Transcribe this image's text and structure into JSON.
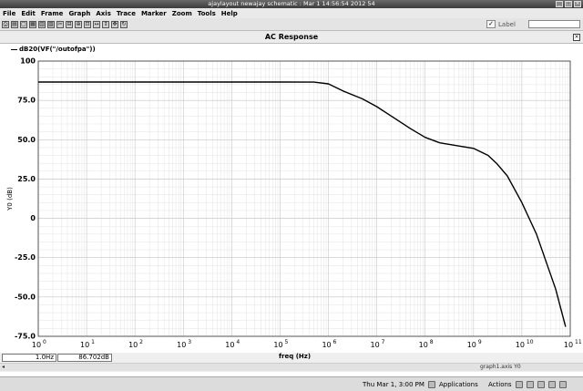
{
  "window": {
    "title": "ajaylayout newajay schematic : Mar  1 14:56:54 2012 54",
    "buttons": [
      "_",
      "□",
      "×"
    ]
  },
  "menubar": [
    "File",
    "Edit",
    "Frame",
    "Graph",
    "Axis",
    "Trace",
    "Marker",
    "Zoom",
    "Tools",
    "Help"
  ],
  "toolbar": {
    "icons": [
      "print-icon",
      "print-preview-icon",
      "frame-icon",
      "graph-icon",
      "strip-icon",
      "table-icon",
      "cut-icon",
      "split-icon",
      "zoom-in-icon",
      "zoom-fit-icon",
      "zoom-x-icon",
      "zoom-y-icon",
      "pan-icon",
      "refresh-icon"
    ],
    "label_checkbox": "✓",
    "label_text": "Label",
    "label_input_value": ""
  },
  "graph": {
    "title": "AC Response",
    "close": "×",
    "legend": "dB20(VF(\"/outofpa\"))"
  },
  "chart_data": {
    "type": "line",
    "title": "AC Response",
    "xlabel": "freq (Hz)",
    "ylabel": "Y0 (dB)",
    "xscale": "log",
    "xlim": [
      1,
      100000000000
    ],
    "ylim": [
      -75,
      100
    ],
    "grid": true,
    "legend_position": "top-left",
    "ytick_labels": [
      "100",
      "75.0",
      "50.0",
      "25.0",
      "0",
      "-25.0",
      "-50.0",
      "-75.0"
    ],
    "ytick_values": [
      100,
      75,
      50,
      25,
      0,
      -25,
      -50,
      -75
    ],
    "xtick_base": "10",
    "xtick_exponents": [
      "0",
      "1",
      "2",
      "3",
      "4",
      "5",
      "6",
      "7",
      "8",
      "9",
      "10",
      "11"
    ],
    "series": [
      {
        "name": "dB20(VF(\"/outofpa\"))",
        "x": [
          1,
          10,
          100,
          1000,
          10000,
          100000,
          500000,
          1000000,
          2000000,
          5000000,
          10000000,
          20000000,
          50000000,
          100000000,
          200000000,
          500000000,
          1000000000,
          2000000000,
          3000000000,
          5000000000,
          10000000000,
          20000000000,
          50000000000,
          80000000000
        ],
        "y": [
          86.7,
          86.7,
          86.7,
          86.7,
          86.7,
          86.7,
          86.6,
          85.5,
          81,
          76,
          71,
          65,
          57,
          51.5,
          48,
          46,
          44.5,
          40,
          35,
          27,
          10,
          -10,
          -45,
          -69
        ]
      }
    ]
  },
  "readout": {
    "x_value": "1.0Hz",
    "y_value": "86.702dB"
  },
  "status": {
    "axis_info": "graph1.axis Y0"
  },
  "taskbar": {
    "clock": "Thu Mar  1,  3:00 PM",
    "applications": "Applications",
    "actions": "Actions"
  }
}
